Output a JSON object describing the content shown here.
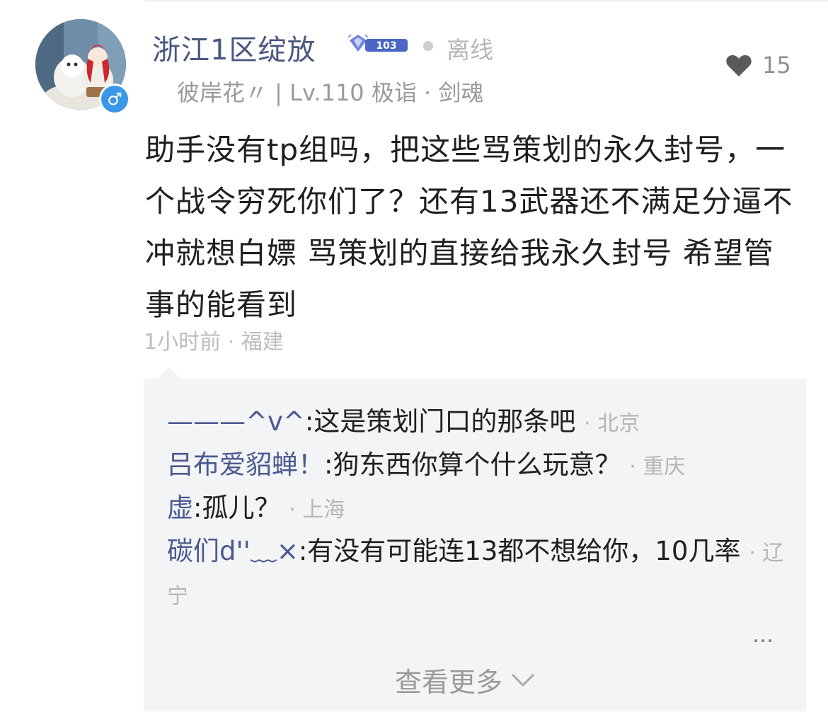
{
  "post": {
    "username": "浙江1区绽放",
    "level_badge_text": "103",
    "status": "离线",
    "sub_info": "彼岸花〃 | Lv.110 极诣 · 剑魂",
    "likes": "15",
    "body": "助手没有tp组吗，把这些骂策划的永久封号，一个战令穷死你们了？还有13武器还不满足分逼不冲就想白嫖 骂策划的直接给我永久封号 希望管事的能看到",
    "time": "1小时前",
    "location": "福建",
    "gender_symbol": "♂"
  },
  "replies": {
    "items": [
      {
        "author": "———^v^",
        "text": ":这是策划门口的那条吧",
        "loc": "北京"
      },
      {
        "author": "吕布爱貂蝉！",
        "text": ":狗东西你算个什么玩意？",
        "loc": "重庆"
      },
      {
        "author": "虚",
        "text": ":孤儿？",
        "loc": "上海"
      },
      {
        "author": "碳们d''﹏×",
        "text": ":有没有可能连13都不想给你，10几率",
        "loc": "辽宁"
      }
    ],
    "more_dots": "…",
    "view_more_label": "查看更多"
  },
  "colors": {
    "username": "#4a5880",
    "reply_author": "#4a5a90",
    "reply_bg": "#f3f4f6",
    "gender_badge": "#3b98e8"
  },
  "icons": {
    "heart": "heart-icon",
    "gender": "male-gender-icon",
    "level": "level-badge-icon",
    "chevron": "chevron-down-icon"
  }
}
